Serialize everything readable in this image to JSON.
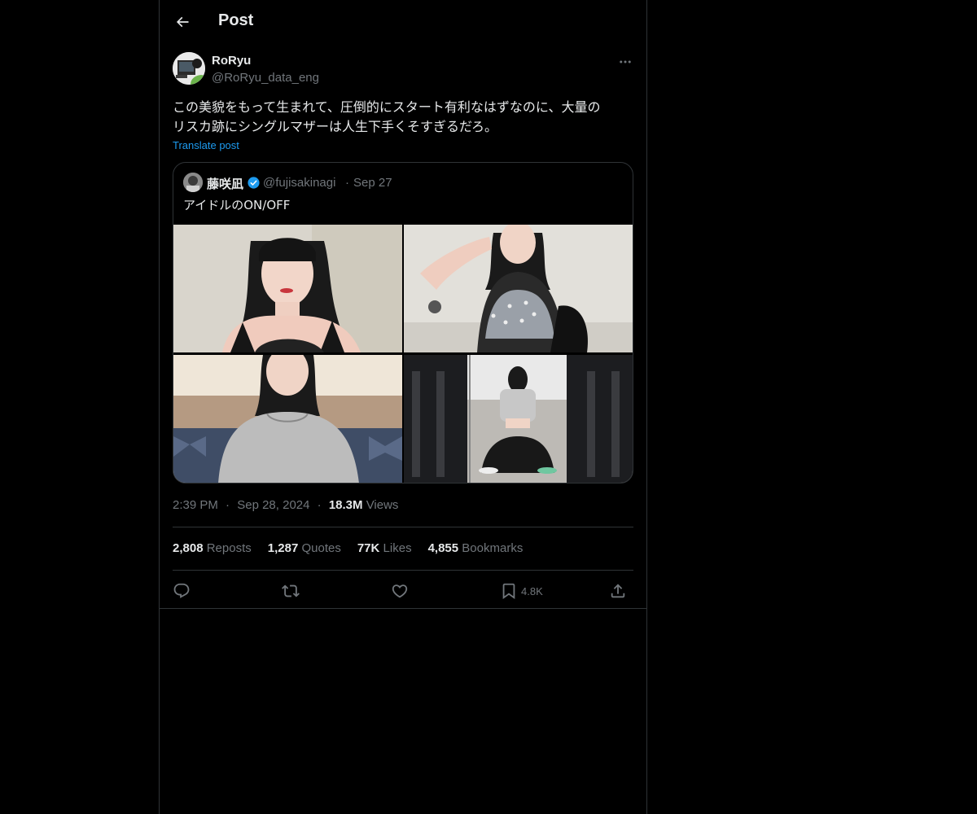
{
  "header": {
    "title": "Post"
  },
  "post": {
    "author_name": "RoRyu",
    "author_handle": "@RoRyu_data_eng",
    "text_line1": "この美貌をもって生まれて、圧倒的にスタート有利なはずなのに、大量の",
    "text_line2": "リスカ跡にシングルマザーは人生下手くそすぎるだろ。",
    "translate_label": "Translate post",
    "time": "2:39 PM",
    "date": "Sep 28, 2024",
    "views_count": "18.3M",
    "views_label": "Views",
    "separator": "·"
  },
  "quote": {
    "name": "藤咲凪",
    "handle": "@fujisakinagi",
    "date": "Sep 27",
    "text": "アイドルのON/OFF"
  },
  "stats": {
    "reposts_count": "2,808",
    "reposts_label": "Reposts",
    "quotes_count": "1,287",
    "quotes_label": "Quotes",
    "likes_count": "77K",
    "likes_label": "Likes",
    "bookmarks_count": "4,855",
    "bookmarks_label": "Bookmarks"
  },
  "actions": {
    "bookmark_count": "4.8K"
  },
  "icons": {
    "back": "arrow-left-icon",
    "more": "more-dots-icon",
    "verified": "verified-badge-icon",
    "reply": "reply-icon",
    "repost": "repost-icon",
    "like": "heart-icon",
    "bookmark": "bookmark-icon",
    "share": "share-icon"
  },
  "colors": {
    "background": "#000000",
    "text": "#e7e9ea",
    "muted": "#71767b",
    "accent": "#1d9bf0",
    "border": "#2f3336"
  }
}
